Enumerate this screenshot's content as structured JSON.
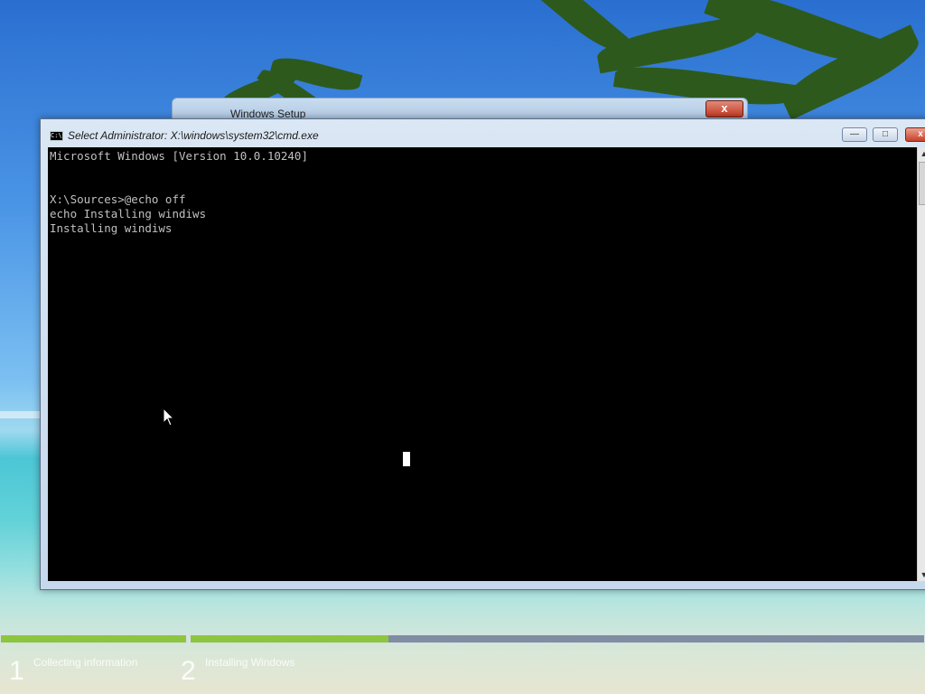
{
  "background_window": {
    "title": "Windows Setup",
    "close_label": "x"
  },
  "cmd_window": {
    "title": "Select Administrator: X:\\windows\\system32\\cmd.exe",
    "icon_text": "C:\\",
    "minimize_label": "—",
    "maximize_label": "□",
    "close_label": "x",
    "lines": [
      "Microsoft Windows [Version 10.0.10240]",
      "",
      "",
      "X:\\Sources>@echo off",
      "echo Installing windiws",
      "Installing windiws"
    ]
  },
  "setup_progress": {
    "steps": [
      {
        "number": "1",
        "label": "Collecting information",
        "progress": 1.0
      },
      {
        "number": "2",
        "label": "Installing Windows",
        "progress": 0.27
      }
    ]
  },
  "icons": {
    "cmd": "cmd-icon",
    "pointer": "mouse-pointer-icon",
    "scroll_up": "scroll-up-arrow-icon",
    "scroll_down": "scroll-down-arrow-icon"
  },
  "colors": {
    "progress_fill": "#8cc63f",
    "console_bg": "#000000",
    "console_text": "#c0c0c0"
  }
}
